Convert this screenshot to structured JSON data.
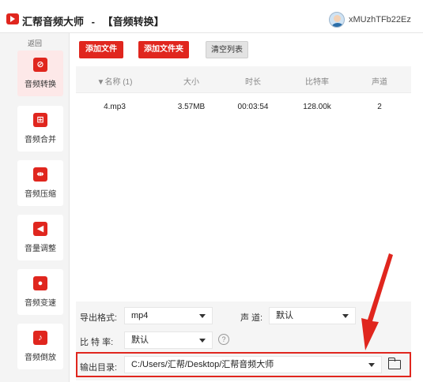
{
  "window": {
    "app_name": "汇帮音频大师",
    "separator": "-",
    "page_title": "【音频转换】",
    "user_name": "xMUzhTFb22Ez"
  },
  "sidebar": {
    "back_label": "返回",
    "items": [
      {
        "label": "音频转换",
        "icon": "convert-icon",
        "glyph": "⊘",
        "active": true
      },
      {
        "label": "音频合并",
        "icon": "merge-icon",
        "glyph": "⊞",
        "active": false
      },
      {
        "label": "音频压缩",
        "icon": "compress-icon",
        "glyph": "⇼",
        "active": false
      },
      {
        "label": "音量调整",
        "icon": "volume-icon",
        "glyph": "◀",
        "active": false
      },
      {
        "label": "音频变速",
        "icon": "speed-mic-icon",
        "glyph": "●",
        "active": false
      },
      {
        "label": "音频倒放",
        "icon": "reverse-music-icon",
        "glyph": "♪",
        "active": false
      }
    ]
  },
  "toolbar": {
    "add_file": "添加文件",
    "add_folder": "添加文件夹",
    "clear_list": "清空列表"
  },
  "table": {
    "columns": [
      "▼名称 (1)",
      "大小",
      "时长",
      "比特率",
      "声道"
    ],
    "rows": [
      [
        "4.mp3",
        "3.57MB",
        "00:03:54",
        "128.00k",
        "2"
      ]
    ]
  },
  "options": {
    "format_label": "导出格式:",
    "format_value": "mp4",
    "channel_label": "声 道:",
    "channel_value": "默认",
    "bitrate_label": "比 特 率:",
    "bitrate_value": "默认",
    "help_glyph": "?",
    "output_label": "输出目录:",
    "output_value": "C:/Users/汇帮/Desktop/汇帮音频大师"
  },
  "colors": {
    "accent": "#e0261e",
    "sidebar_bg": "#f4f4f4",
    "panel_bg": "#f5f5f5"
  }
}
